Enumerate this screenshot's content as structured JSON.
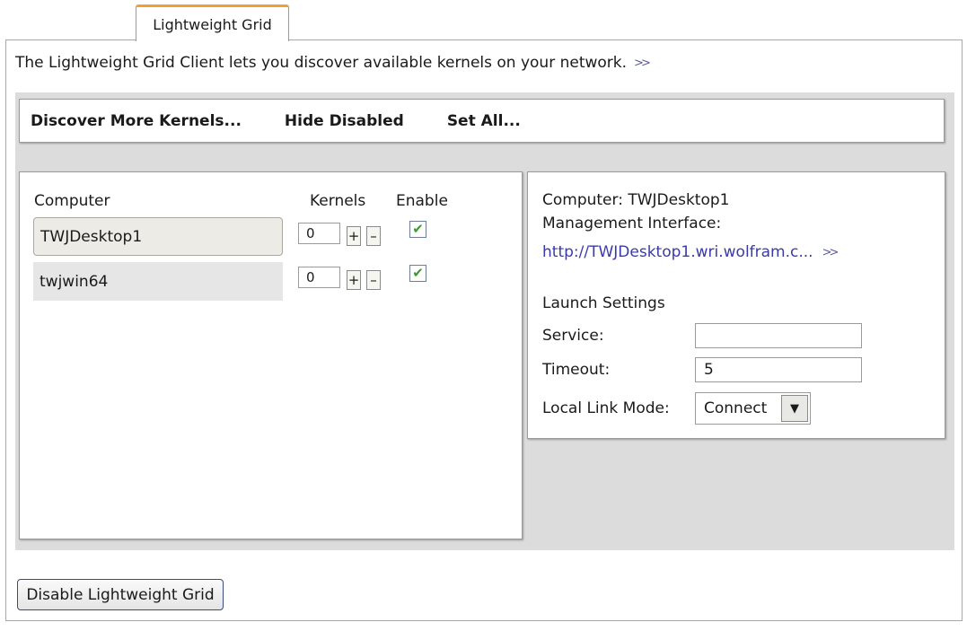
{
  "tab": {
    "label": "Lightweight Grid"
  },
  "intro": {
    "text": "The Lightweight Grid Client lets you discover available kernels on your network.",
    "more_glyph": ">>"
  },
  "toolbar": {
    "discover": "Discover More Kernels...",
    "hide_disabled": "Hide Disabled",
    "set_all": "Set All..."
  },
  "table": {
    "col_computer": "Computer",
    "col_kernels": "Kernels",
    "col_enable": "Enable",
    "rows": [
      {
        "computer": "TWJDesktop1",
        "kernels": "0",
        "enabled": true,
        "selected": true
      },
      {
        "computer": "twjwin64",
        "kernels": "0",
        "enabled": true,
        "selected": false
      }
    ],
    "plus": "+",
    "minus": "–",
    "check_glyph": "✔"
  },
  "details": {
    "computer": "Computer: TWJDesktop1",
    "mgmt_label": "Management Interface:",
    "mgmt_link": "http://TWJDesktop1.wri.wolfram.c...",
    "more_glyph": ">>",
    "launch_settings": "Launch Settings",
    "service_label": "Service:",
    "service_value": "",
    "timeout_label": "Timeout:",
    "timeout_value": "5",
    "link_mode_label": "Local Link Mode:",
    "link_mode_value": "Connect",
    "dropdown_glyph": "▼"
  },
  "footer": {
    "disable_button": "Disable Lightweight Grid"
  },
  "colors": {
    "tab_accent": "#f0a030",
    "link": "#3a3aaa",
    "check": "#3a9a30",
    "panel_bg": "#dcdcdc"
  }
}
